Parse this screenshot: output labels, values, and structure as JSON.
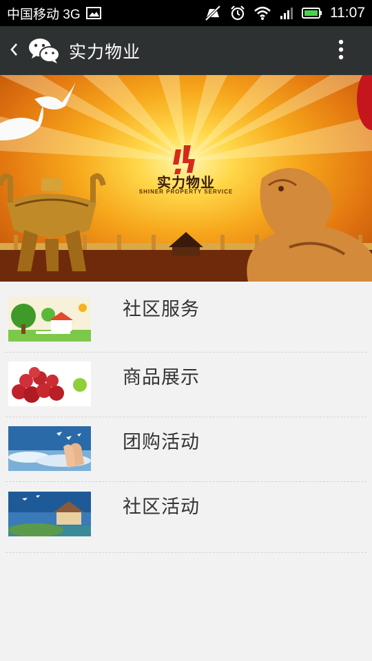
{
  "status_bar": {
    "carrier": "中国移动 3G",
    "time": "11:07",
    "icons": [
      "image-icon",
      "mute-icon",
      "alarm-icon",
      "wifi-icon",
      "signal-icon",
      "battery-icon"
    ]
  },
  "header": {
    "title": "实力物业",
    "back_icon": "chevron-left-icon",
    "logo_icon": "wechat-icon",
    "menu_icon": "more-vertical-icon",
    "background": "#2e3132"
  },
  "banner": {
    "brand_name": "实力物业",
    "brand_subtitle": "SHINER PROPERTY SERVICE",
    "accent": "#d42a1a"
  },
  "menu": {
    "items": [
      {
        "label": "社区服务",
        "thumb": "community-service-thumbnail"
      },
      {
        "label": "商品展示",
        "thumb": "apples-thumbnail"
      },
      {
        "label": "团购活动",
        "thumb": "group-buy-thumbnail"
      },
      {
        "label": "社区活动",
        "thumb": "community-activity-thumbnail"
      }
    ]
  }
}
